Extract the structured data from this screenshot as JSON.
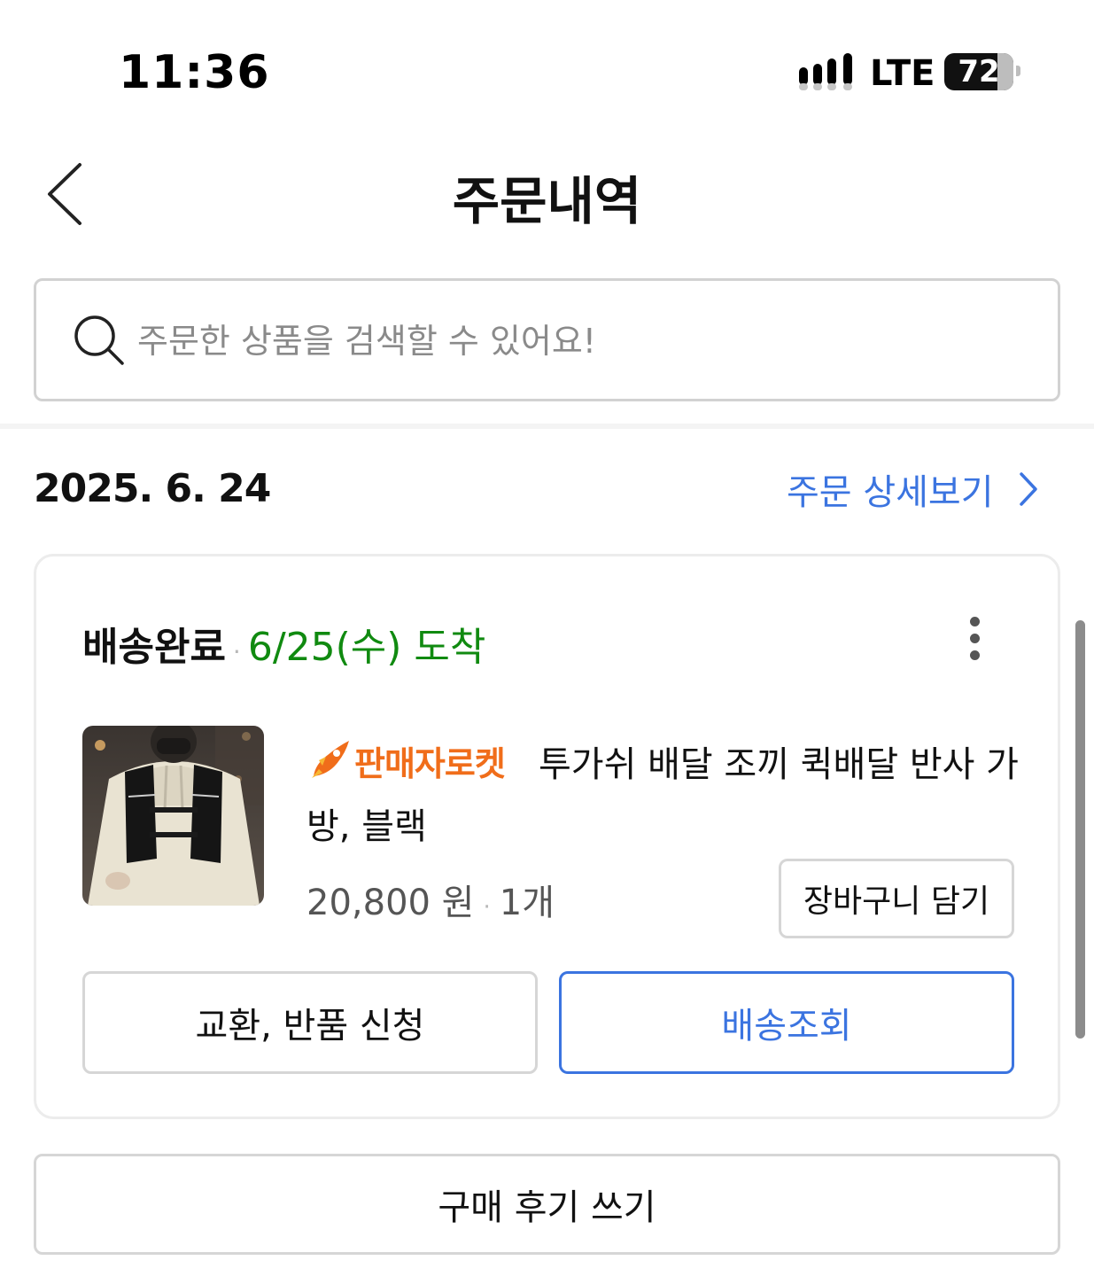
{
  "status_bar": {
    "time": "11:36",
    "network": "LTE",
    "battery_level": "72"
  },
  "header": {
    "title": "주문내역"
  },
  "search": {
    "placeholder": "주문한 상품을 검색할 수 있어요!",
    "value": ""
  },
  "order": {
    "date": "2025. 6. 24",
    "detail_link_label": "주문 상세보기",
    "delivery_status": "배송완료",
    "arrival_date": "6/25(수) 도착",
    "product": {
      "badge": "판매자로켓",
      "name": "투가쉬 배달 조끼 퀵배달 반사 가방, 블랙",
      "price": "20,800 원",
      "quantity": "1개"
    },
    "add_to_cart_label": "장바구니 담기",
    "return_label": "교환, 반품 신청",
    "track_label": "배송조회"
  },
  "review_button_label": "구매 후기 쓰기",
  "colors": {
    "accent_blue": "#3b74e0",
    "arrival_green": "#108a10",
    "rocket_orange": "#f06d1a"
  }
}
